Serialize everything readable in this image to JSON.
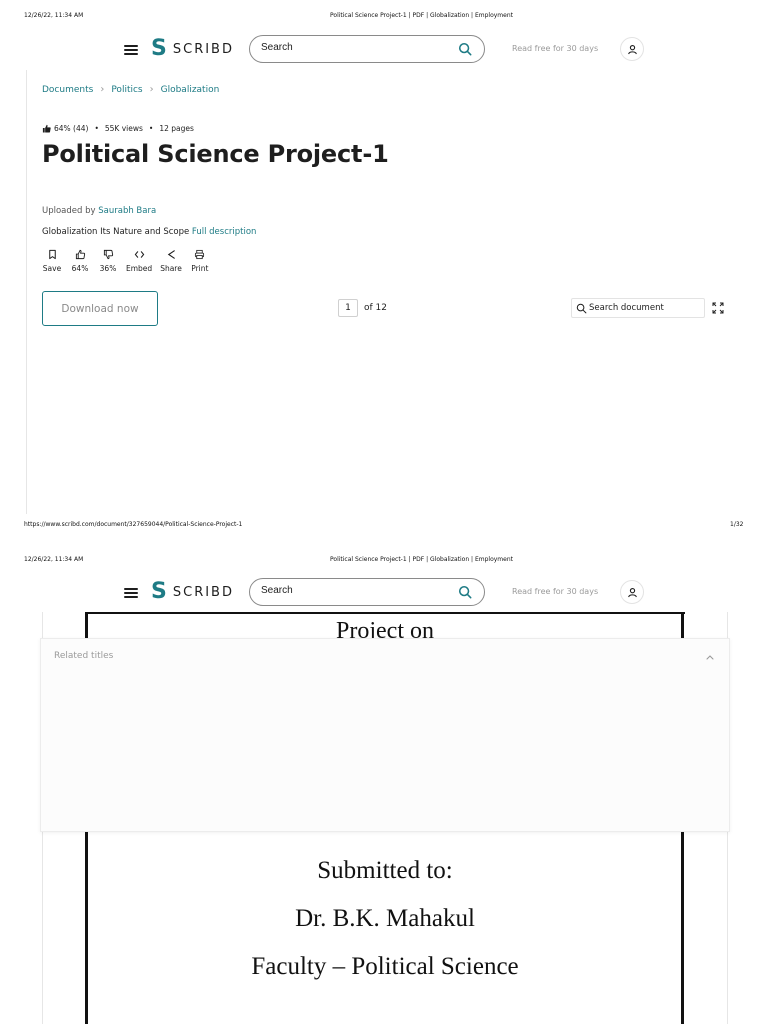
{
  "print_header": {
    "datetime": "12/26/22, 11:34 AM",
    "doc_title": "Political Science Project-1 | PDF | Globalization | Employment"
  },
  "print_footer": {
    "url": "https://www.scribd.com/document/327659044/Political-Science-Project-1",
    "page": "1/32"
  },
  "header": {
    "logo_text": "SCRIBD",
    "search_placeholder": "Search",
    "trial_text": "Read free for 30 days"
  },
  "breadcrumb": [
    "Documents",
    "Politics",
    "Globalization"
  ],
  "stats": {
    "rating": "64% (44)",
    "views": "55K views",
    "pages": "12 pages"
  },
  "title": "Political Science Project-1",
  "uploader": {
    "label": "Uploaded by",
    "name": "Saurabh Bara"
  },
  "description": {
    "text": "Globalization Its Nature and Scope",
    "link": "Full description"
  },
  "actions": [
    {
      "label": "Save",
      "icon": "bookmark-icon"
    },
    {
      "label": "64%",
      "icon": "thumbs-up-icon"
    },
    {
      "label": "36%",
      "icon": "thumbs-down-icon"
    },
    {
      "label": "Embed",
      "icon": "code-icon"
    },
    {
      "label": "Share",
      "icon": "share-icon"
    },
    {
      "label": "Print",
      "icon": "print-icon"
    }
  ],
  "download_label": "Download now",
  "pager": {
    "current": "1",
    "total": "of 12"
  },
  "doc_search_placeholder": "Search document",
  "related_label": "Related titles",
  "document_page": {
    "heading": "Project on",
    "submitted_to": "Submitted to:",
    "name": "Dr. B.K. Mahakul",
    "faculty": "Faculty – Political Science"
  },
  "colors": {
    "accent": "#1e7b85",
    "muted": "#9a9a9a",
    "text": "#1e1e1e"
  }
}
